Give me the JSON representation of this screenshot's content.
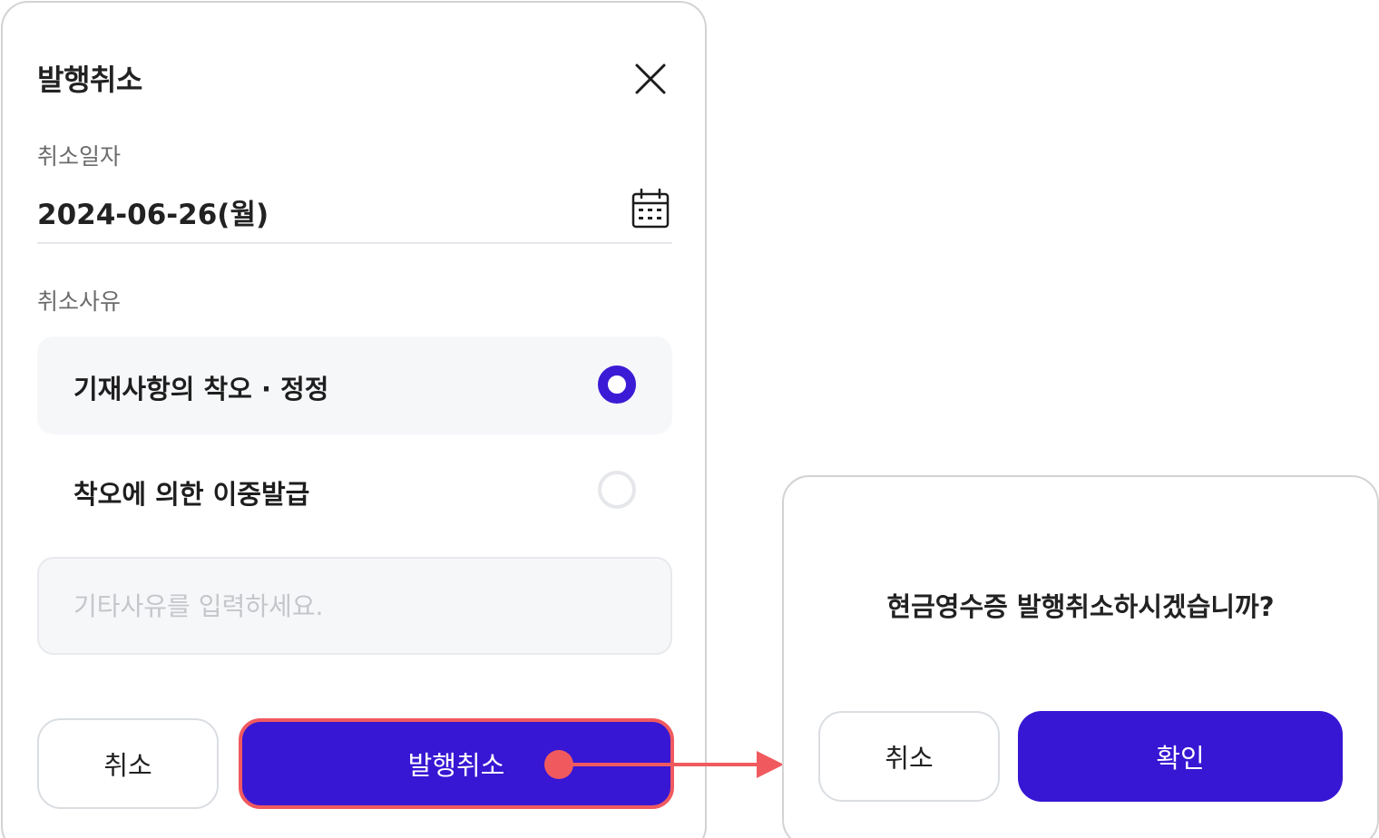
{
  "panel": {
    "title": "발행취소",
    "close_icon": "close-icon",
    "date_label": "취소일자",
    "date_value": "2024-06-26(월)",
    "calendar_icon": "calendar-icon",
    "reason_label": "취소사유",
    "reasons": [
      {
        "label": "기재사항의 착오 · 정정",
        "selected": true
      },
      {
        "label": "착오에 의한 이중발급",
        "selected": false
      }
    ],
    "other_reason_placeholder": "기타사유를 입력하세요.",
    "other_reason_value": "",
    "cancel_button": "취소",
    "issue_cancel_button": "발행취소"
  },
  "dialog": {
    "message": "현금영수증 발행취소하시겠습니까?",
    "cancel_button": "취소",
    "confirm_button": "확인"
  },
  "colors": {
    "primary": "#3717d3",
    "highlight": "#f05a5f",
    "radio_selected": "#3c1bd6"
  }
}
